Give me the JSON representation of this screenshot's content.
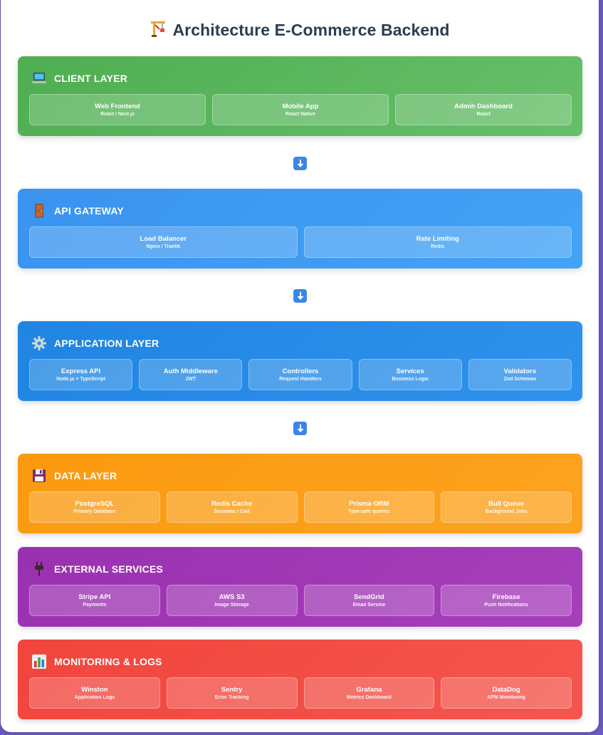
{
  "title": "Architecture E-Commerce Backend",
  "layers": [
    {
      "id": "client",
      "name": "CLIENT LAYER",
      "icon": "laptop-icon",
      "color": "#57b65a",
      "cards": [
        {
          "name": "Web Frontend",
          "tech": "React / Next.js"
        },
        {
          "name": "Mobile App",
          "tech": "React Native"
        },
        {
          "name": "Admin Dashboard",
          "tech": "React"
        }
      ]
    },
    {
      "id": "gateway",
      "name": "API GATEWAY",
      "icon": "door-icon",
      "color": "#3d9cf2",
      "cards": [
        {
          "name": "Load Balancer",
          "tech": "Nginx / Traefik"
        },
        {
          "name": "Rate Limiting",
          "tech": "Redis"
        }
      ]
    },
    {
      "id": "app",
      "name": "APPLICATION LAYER",
      "icon": "gear-icon",
      "color": "#238ae6",
      "cards": [
        {
          "name": "Express API",
          "tech": "Node.js + TypeScript"
        },
        {
          "name": "Auth Middleware",
          "tech": "JWT"
        },
        {
          "name": "Controllers",
          "tech": "Request Handlers"
        },
        {
          "name": "Services",
          "tech": "Business Logic"
        },
        {
          "name": "Validators",
          "tech": "Zod Schemas"
        }
      ]
    },
    {
      "id": "data",
      "name": "DATA LAYER",
      "icon": "floppy-disk-icon",
      "color": "#fb9c12",
      "cards": [
        {
          "name": "PostgreSQL",
          "tech": "Primary Database"
        },
        {
          "name": "Redis Cache",
          "tech": "Sessions / Cart"
        },
        {
          "name": "Prisma ORM",
          "tech": "Type-safe queries"
        },
        {
          "name": "Bull Queue",
          "tech": "Background Jobs"
        }
      ]
    },
    {
      "id": "external",
      "name": "EXTERNAL SERVICES",
      "icon": "plug-icon",
      "color": "#9f35b4",
      "cards": [
        {
          "name": "Stripe API",
          "tech": "Payments"
        },
        {
          "name": "AWS S3",
          "tech": "Image Storage"
        },
        {
          "name": "SendGrid",
          "tech": "Email Service"
        },
        {
          "name": "Firebase",
          "tech": "Push Notifications"
        }
      ]
    },
    {
      "id": "monitoring",
      "name": "MONITORING & LOGS",
      "icon": "bar-chart-icon",
      "color": "#f24c43",
      "cards": [
        {
          "name": "Winston",
          "tech": "Application Logs"
        },
        {
          "name": "Sentry",
          "tech": "Error Tracking"
        },
        {
          "name": "Grafana",
          "tech": "Metrics Dashboard"
        },
        {
          "name": "DataDog",
          "tech": "APM Monitoring"
        }
      ]
    }
  ],
  "arrow_icon": "down-arrow-icon"
}
